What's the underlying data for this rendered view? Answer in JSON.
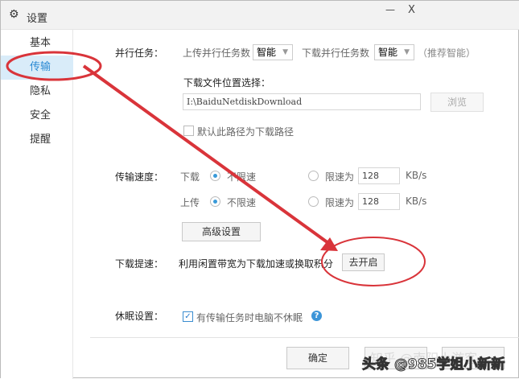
{
  "window": {
    "title": "设置",
    "minimize": "—",
    "close": "X"
  },
  "sidebar": {
    "items": [
      {
        "label": "基本"
      },
      {
        "label": "传输"
      },
      {
        "label": "隐私"
      },
      {
        "label": "安全"
      },
      {
        "label": "提醒"
      }
    ],
    "active": "传输"
  },
  "parallel": {
    "label": "并行任务：",
    "upload_label": "上传并行任务数",
    "upload_value": "智能",
    "download_label": "下载并行任务数",
    "download_value": "智能",
    "hint": "（推荐智能）"
  },
  "location": {
    "label": "下载文件位置选择：",
    "path": "I:\\BaiduNetdiskDownload",
    "browse": "浏览",
    "default_check": "默认此路径为下载路径",
    "default_checked": false
  },
  "speed": {
    "label": "传输速度：",
    "download": {
      "label": "下载",
      "unlimited": "不限速",
      "limit": "限速为",
      "value": "128",
      "unit": "KB/s",
      "selected": "unlimited"
    },
    "upload": {
      "label": "上传",
      "unlimited": "不限速",
      "limit": "限速为",
      "value": "128",
      "unit": "KB/s",
      "selected": "unlimited"
    },
    "advanced": "高级设置"
  },
  "boost": {
    "label": "下载提速：",
    "desc": "利用闲置带宽为下载加速或换取积分",
    "button": "去开启"
  },
  "sleep": {
    "label": "休眠设置：",
    "check": "有传输任务时电脑不休眠",
    "checked": true
  },
  "footer": {
    "ok": "确定"
  },
  "watermark": {
    "text1": "知乎 @南阳小游客",
    "text2": "头条 @985学姐小新新"
  },
  "annotation_color": "#d9343a"
}
